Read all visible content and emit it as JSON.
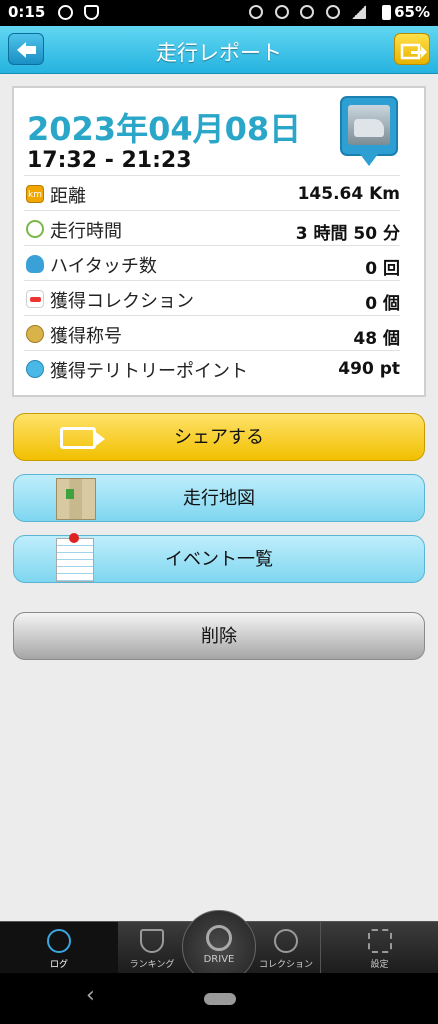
{
  "status_bar": {
    "time": "0:15",
    "battery": "65%"
  },
  "header": {
    "title": "走行レポート"
  },
  "report": {
    "date": "2023年04月08日",
    "time_range": "17:32 - 21:23",
    "rows": [
      {
        "icon": "km-badge-icon",
        "icon_text": "km",
        "label": "距離",
        "value": "145.64 Km"
      },
      {
        "icon": "clock-icon",
        "label": "走行時間",
        "value": "3 時間 50 分"
      },
      {
        "icon": "high-five-icon",
        "label": "ハイタッチ数",
        "value": "0 回"
      },
      {
        "icon": "car-icon",
        "label": "獲得コレクション",
        "value": "0 個"
      },
      {
        "icon": "medal-icon",
        "label": "獲得称号",
        "value": "48 個"
      },
      {
        "icon": "territory-icon",
        "label": "獲得テリトリーポイント",
        "value": "490 pt"
      }
    ]
  },
  "actions": {
    "share": "シェアする",
    "map": "走行地図",
    "events": "イベント一覧",
    "delete": "削除"
  },
  "tabs": {
    "log": "ログ",
    "ranking": "ランキング",
    "drive": "DRIVE",
    "collection": "コレクション",
    "settings": "設定"
  },
  "colors": {
    "header": "#25b3e0",
    "date": "#2aa6c9",
    "share_button": "#f1c000",
    "nav_button": "#7fd6f0",
    "delete_button": "#a6a6a6"
  }
}
